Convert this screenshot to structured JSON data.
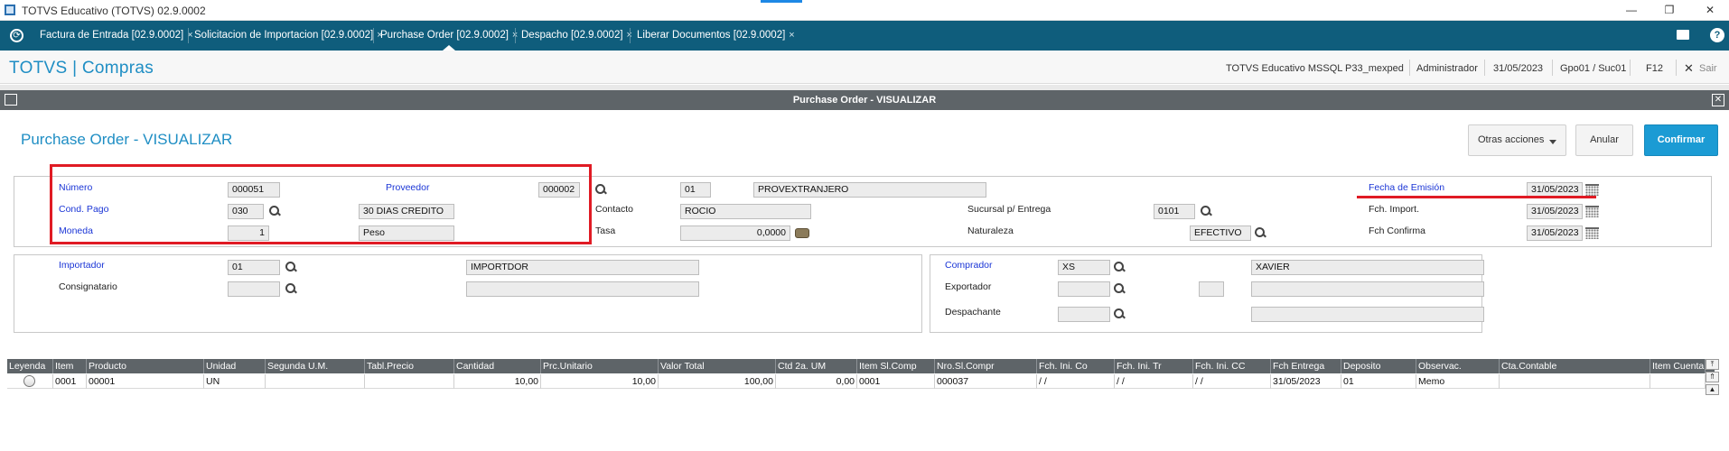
{
  "window": {
    "title": "TOTVS Educativo (TOTVS) 02.9.0002",
    "minimize": "—",
    "restore": "❐",
    "close": "✕"
  },
  "tabs": [
    {
      "label": "Factura de Entrada [02.9.0002]"
    },
    {
      "label": "Solicitacion de Importacion [02.9.0002]"
    },
    {
      "label": "Purchase Order [02.9.0002]",
      "active": true
    },
    {
      "label": "Despacho [02.9.0002]"
    },
    {
      "label": "Liberar Documentos [02.9.0002]"
    }
  ],
  "tab_close": "×",
  "header": {
    "brand": "TOTVS | Compras",
    "environment": "TOTVS Educativo MSSQL P33_mexped",
    "user": "Administrador",
    "date": "31/05/2023",
    "branch": "Gpo01 / Suc01",
    "shortcut": "F12",
    "exit_icon": "✕",
    "exit": "Sair"
  },
  "dialog": {
    "title": "Purchase Order - VISUALIZAR",
    "close": "✕"
  },
  "form": {
    "title": "Purchase Order - VISUALIZAR",
    "buttons": {
      "other_actions": "Otras acciones",
      "cancel": "Anular",
      "confirm": "Confirmar"
    },
    "numero": {
      "label": "Número",
      "value": "000051"
    },
    "proveedor": {
      "label": "Proveedor",
      "code": "000002",
      "store": "01",
      "name": "PROVEXTRANJERO"
    },
    "cond_pago": {
      "label": "Cond. Pago",
      "code": "030",
      "desc": "30 DIAS CREDITO"
    },
    "moneda": {
      "label": "Moneda",
      "code": "1",
      "desc": "Peso"
    },
    "contacto": {
      "label": "Contacto",
      "value": "ROCIO"
    },
    "tasa": {
      "label": "Tasa",
      "value": "0,0000"
    },
    "sucursal_entrega": {
      "label": "Sucursal p/ Entrega",
      "value": "0101"
    },
    "naturaleza": {
      "label": "Naturaleza",
      "value": "EFECTIVO"
    },
    "fecha_emision": {
      "label": "Fecha de Emisión",
      "value": "31/05/2023"
    },
    "fch_import": {
      "label": "Fch. Import.",
      "value": "31/05/2023"
    },
    "fch_confirma": {
      "label": "Fch Confirma",
      "value": "31/05/2023"
    },
    "importador": {
      "label": "Importador",
      "code": "01",
      "name": "IMPORTDOR"
    },
    "consignatario": {
      "label": "Consignatario",
      "code": "",
      "name": ""
    },
    "comprador": {
      "label": "Comprador",
      "code": "XS",
      "name": "XAVIER"
    },
    "exportador": {
      "label": "Exportador",
      "code": "",
      "store": "",
      "name": ""
    },
    "despachante": {
      "label": "Despachante",
      "code": "",
      "name": ""
    }
  },
  "grid": {
    "columns": [
      "Leyenda",
      "Item",
      "Producto",
      "Unidad",
      "Segunda U.M.",
      "Tabl.Precio",
      "Cantidad",
      "Prc.Unitario",
      "Valor Total",
      "Ctd 2a. UM",
      "Item Sl.Comp",
      "Nro.Sl.Compr",
      "Fch. Ini. Co",
      "Fch. Ini. Tr",
      "Fch. Ini. CC",
      "Fch Entrega",
      "Deposito",
      "Observac.",
      "Cta.Contable",
      "Item Cuenta"
    ],
    "rows": [
      [
        "",
        "0001",
        "00001",
        "UN",
        "",
        "",
        "10,00",
        "10,00",
        "100,00",
        "0,00",
        "0001",
        "000037",
        " / /",
        " / /",
        " / /",
        "31/05/2023",
        "01",
        "Memo",
        "",
        ""
      ]
    ]
  },
  "colors": {
    "brand": "#1f8ec4",
    "tabbar": "#0f5d7c",
    "confirm": "#1b9bd4",
    "required_label": "#1a35d6",
    "highlight": "#e01b24"
  }
}
